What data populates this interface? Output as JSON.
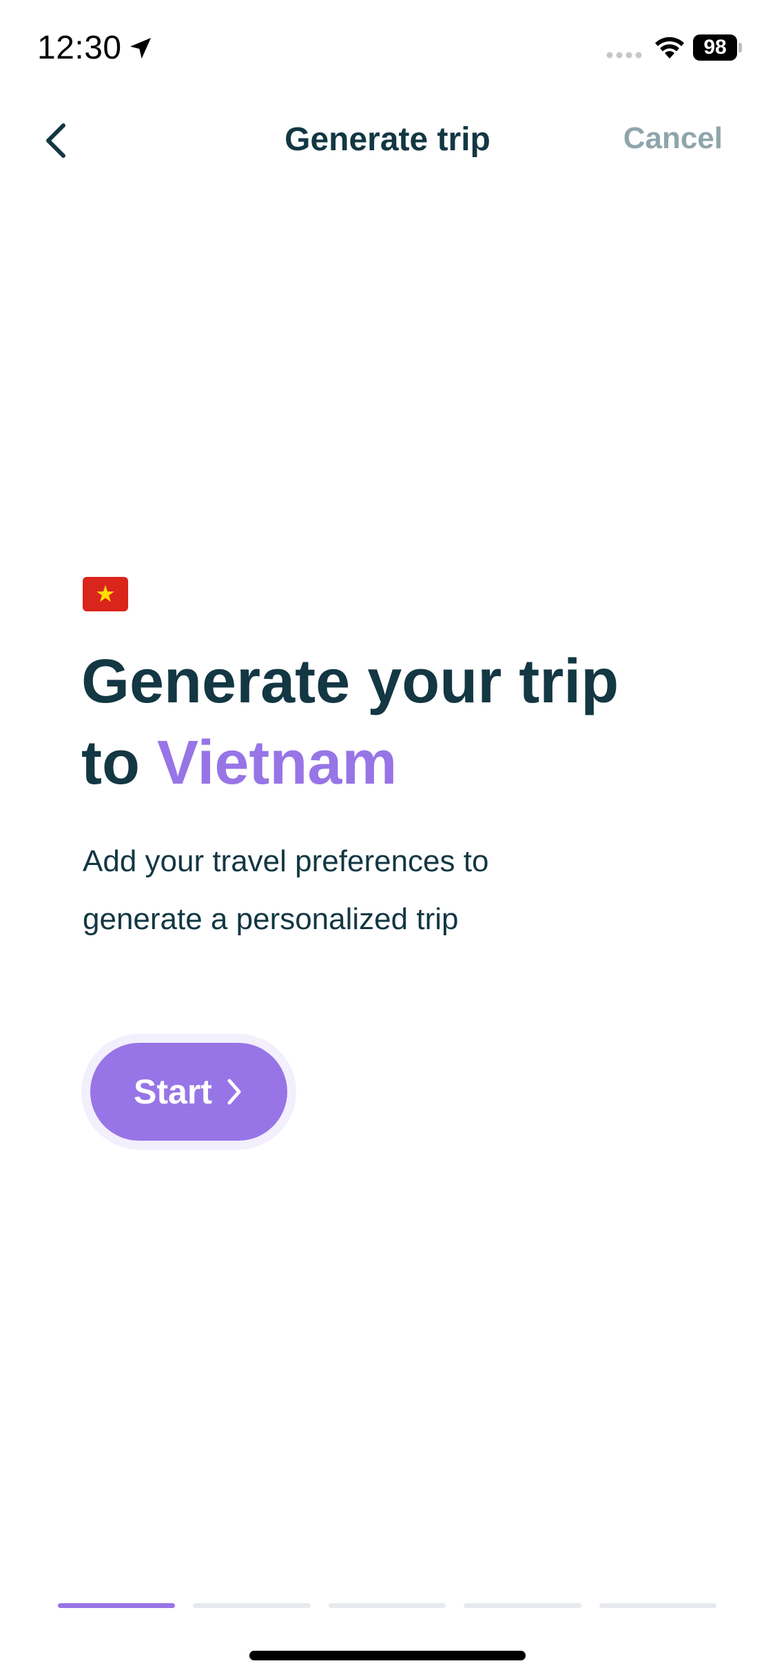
{
  "status_bar": {
    "time": "12:30",
    "battery": "98",
    "icons": [
      "location-arrow-icon",
      "cellular-signal-icon",
      "wifi-icon",
      "battery-icon"
    ]
  },
  "nav": {
    "back_icon": "chevron-left-icon",
    "title": "Generate trip",
    "cancel_label": "Cancel"
  },
  "hero": {
    "flag_icon": "vietnam-flag-icon",
    "title_line1": "Generate your trip",
    "title_prefix": "to",
    "destination": "Vietnam",
    "subtitle_line1": "Add your travel preferences to",
    "subtitle_line2": "generate a personalized trip"
  },
  "start_button": {
    "label": "Start",
    "icon": "chevron-right-icon"
  },
  "progress": {
    "total_steps": 5,
    "current_step": 1
  },
  "colors": {
    "primary_text": "#133743",
    "accent": "#9775e6",
    "muted": "#8fa5ab",
    "progress_inactive": "#e6eaee",
    "flag_red": "#da251d",
    "flag_star": "#ffde00"
  }
}
